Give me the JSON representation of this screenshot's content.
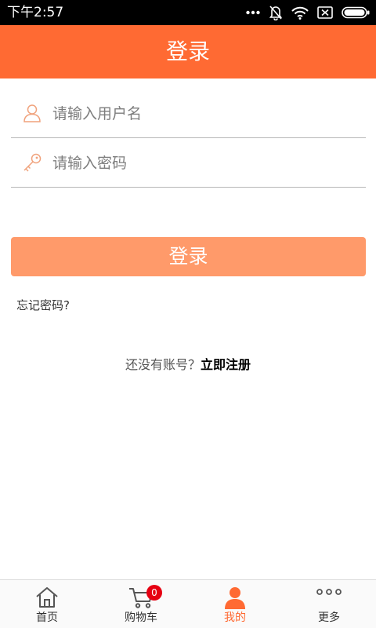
{
  "status_bar": {
    "time": "下午2:57",
    "icons": [
      "more-dots-icon",
      "bell-muted-icon",
      "wifi-icon",
      "sim-disabled-icon",
      "battery-icon"
    ]
  },
  "header": {
    "title": "登录"
  },
  "form": {
    "username": {
      "placeholder": "请输入用户名",
      "value": "",
      "icon": "user-icon"
    },
    "password": {
      "placeholder": "请输入密码",
      "value": "",
      "icon": "key-icon"
    },
    "login_button": "登录",
    "forgot_password": "忘记密码?",
    "register_prompt": "还没有账号？",
    "register_link": "立即注册"
  },
  "tab_bar": {
    "tabs": [
      {
        "label": "首页",
        "icon": "home-icon",
        "active": false
      },
      {
        "label": "购物车",
        "icon": "cart-icon",
        "active": false,
        "badge": "0"
      },
      {
        "label": "我的",
        "icon": "person-icon",
        "active": true
      },
      {
        "label": "更多",
        "icon": "more-icon",
        "active": false
      }
    ]
  },
  "colors": {
    "accent": "#ff6a33",
    "button": "#ff9a6a",
    "badge": "#e60012",
    "status_bar": "#000000"
  }
}
